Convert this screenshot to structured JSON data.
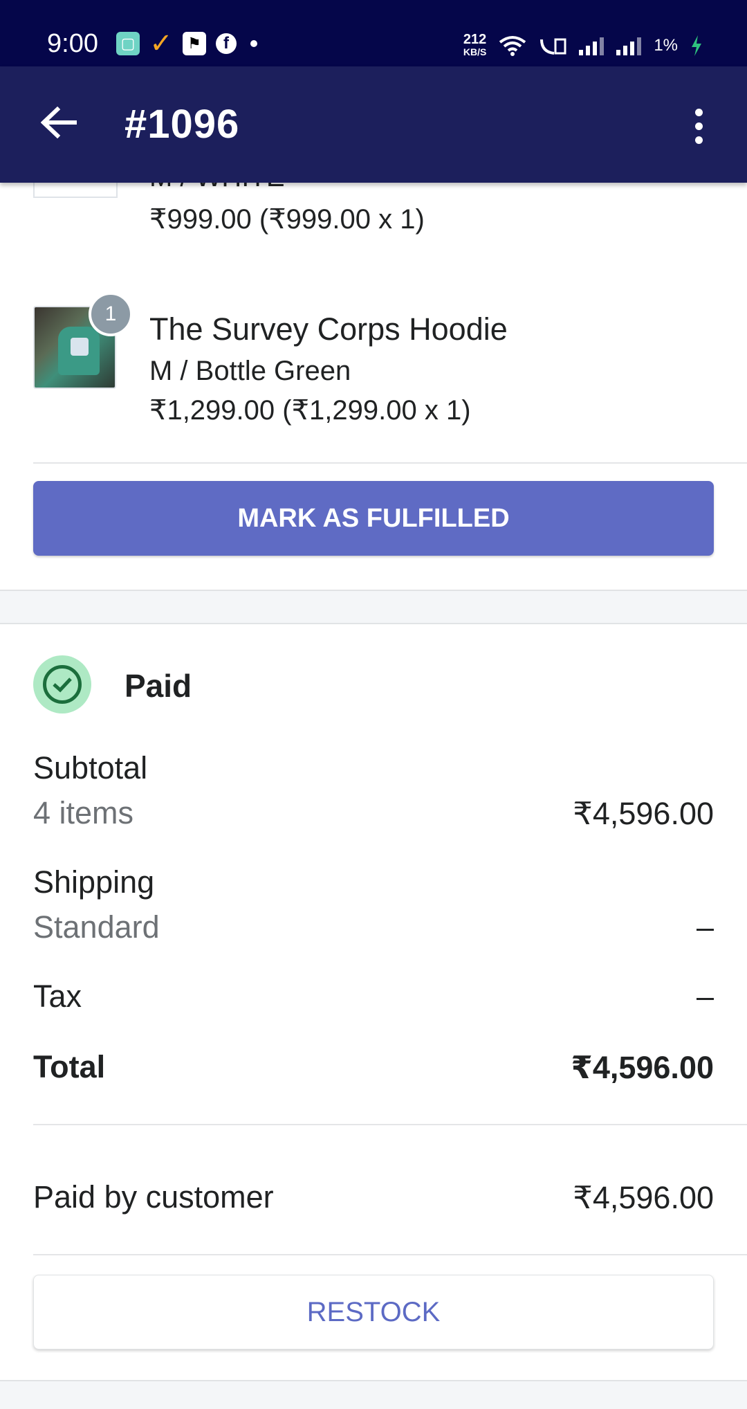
{
  "status_bar": {
    "time": "9:00",
    "speed_value": "212",
    "speed_unit": "KB/S",
    "battery": "1%",
    "icons": [
      "message-app-icon",
      "check-app-icon",
      "flag-app-icon",
      "facebook-icon",
      "dot-icon",
      "wifi-icon",
      "volte-icon",
      "signal-icon",
      "signal-icon-2",
      "charging-icon"
    ]
  },
  "app_bar": {
    "title": "#1096",
    "back_icon": "arrow-left-icon",
    "more_icon": "more-vertical-icon"
  },
  "line_items": [
    {
      "title": "",
      "variant": "M / WHITE",
      "price": "₹999.00 (₹999.00 x 1)"
    },
    {
      "title": "The Survey Corps Hoodie",
      "variant": "M / Bottle Green",
      "price": "₹1,299.00 (₹1,299.00 x 1)",
      "quantity": "1"
    }
  ],
  "fulfill_button": "MARK AS FULFILLED",
  "payment": {
    "status": "Paid",
    "subtotal_label": "Subtotal",
    "subtotal_items": "4 items",
    "subtotal_value": "₹4,596.00",
    "shipping_label": "Shipping",
    "shipping_method": "Standard",
    "shipping_value": "–",
    "tax_label": "Tax",
    "tax_value": "–",
    "total_label": "Total",
    "total_value": "₹4,596.00",
    "paid_by_label": "Paid by customer",
    "paid_by_value": "₹4,596.00"
  },
  "restock_button": "RESTOCK",
  "colors": {
    "status_bar": "#05064a",
    "app_bar": "#1c1f5c",
    "primary_button": "#5f6bc4",
    "restock_text": "#5c6ac4",
    "paid_badge": "#aee9c4",
    "paid_check": "#1b6e3c"
  }
}
